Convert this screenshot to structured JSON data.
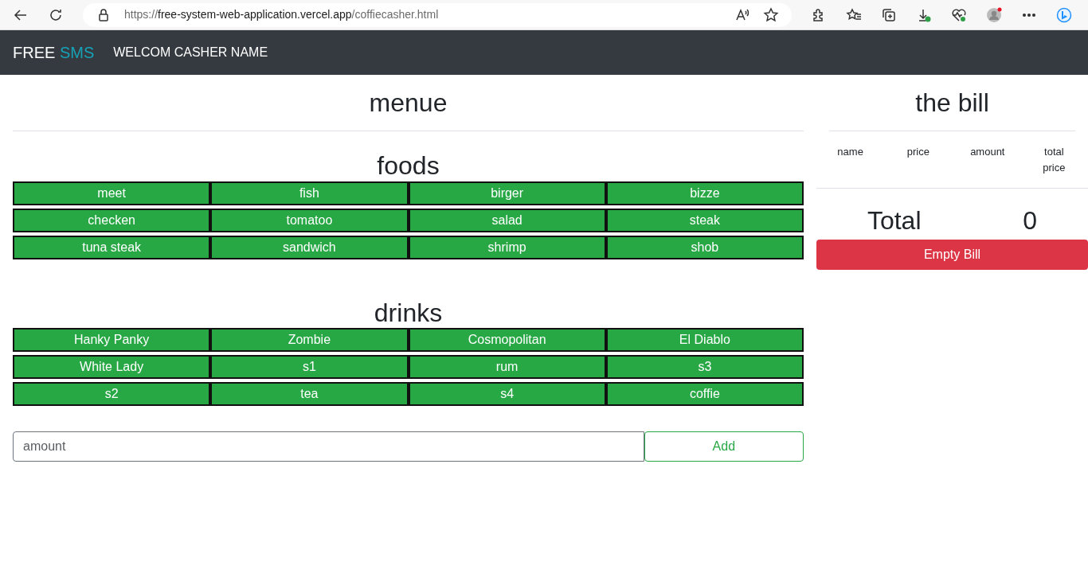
{
  "browser": {
    "url_parts": [
      {
        "text": "https://",
        "kind": "dim"
      },
      {
        "text": "free-system-web-application.vercel.app",
        "kind": "strong"
      },
      {
        "text": "/coffiecasher.html",
        "kind": "dim"
      }
    ],
    "profile_alert": true
  },
  "navbar": {
    "brand_parts": [
      {
        "text": "FREE",
        "kind": "plain"
      },
      {
        "text": "SMS",
        "kind": "accent"
      }
    ],
    "greeting": "WELCOM CASHER NAME"
  },
  "menu": {
    "title": "menue",
    "sections": [
      {
        "title": "foods",
        "items": [
          "meet",
          "fish",
          "birger",
          "bizze",
          "checken",
          "tomatoo",
          "salad",
          "steak",
          "tuna steak",
          "sandwich",
          "shrimp",
          "shob"
        ]
      },
      {
        "title": "drinks",
        "items": [
          "Hanky Panky",
          "Zombie",
          "Cosmopolitan",
          "El Diablo",
          "White Lady",
          "s1",
          "rum",
          "s3",
          "s2",
          "tea",
          "s4",
          "coffie"
        ]
      }
    ],
    "amount": {
      "placeholder": "amount"
    },
    "add_button": "Add"
  },
  "bill": {
    "title": "the bill",
    "columns": [
      "name",
      "price",
      "amount",
      "total price"
    ],
    "total_label": "Total",
    "total_value": "0",
    "empty_button": "Empty Bill"
  }
}
